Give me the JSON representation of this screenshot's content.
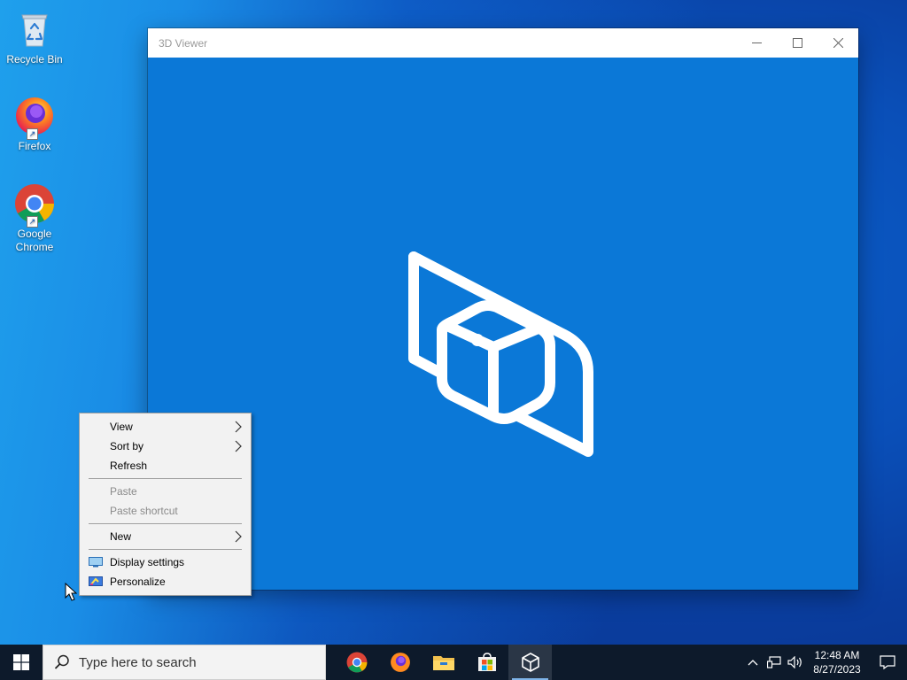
{
  "desktop": {
    "icons": [
      {
        "label": "Recycle Bin"
      },
      {
        "label": "Firefox"
      },
      {
        "label": "Google Chrome"
      }
    ]
  },
  "window": {
    "title": "3D Viewer",
    "background_color": "#0b78d7"
  },
  "context_menu": {
    "items": [
      {
        "label": "View",
        "submenu": true
      },
      {
        "label": "Sort by",
        "submenu": true
      },
      {
        "label": "Refresh"
      },
      {
        "label": "Paste",
        "disabled": true
      },
      {
        "label": "Paste shortcut",
        "disabled": true
      },
      {
        "label": "New",
        "submenu": true
      },
      {
        "label": "Display settings",
        "icon": "display-icon"
      },
      {
        "label": "Personalize",
        "icon": "personalize-icon"
      }
    ]
  },
  "taskbar": {
    "search_placeholder": "Type here to search",
    "apps": [
      "chrome-icon",
      "firefox-icon",
      "file-explorer-icon",
      "store-icon",
      "3d-viewer-icon"
    ],
    "time": "12:48 AM",
    "date": "8/27/2023"
  }
}
